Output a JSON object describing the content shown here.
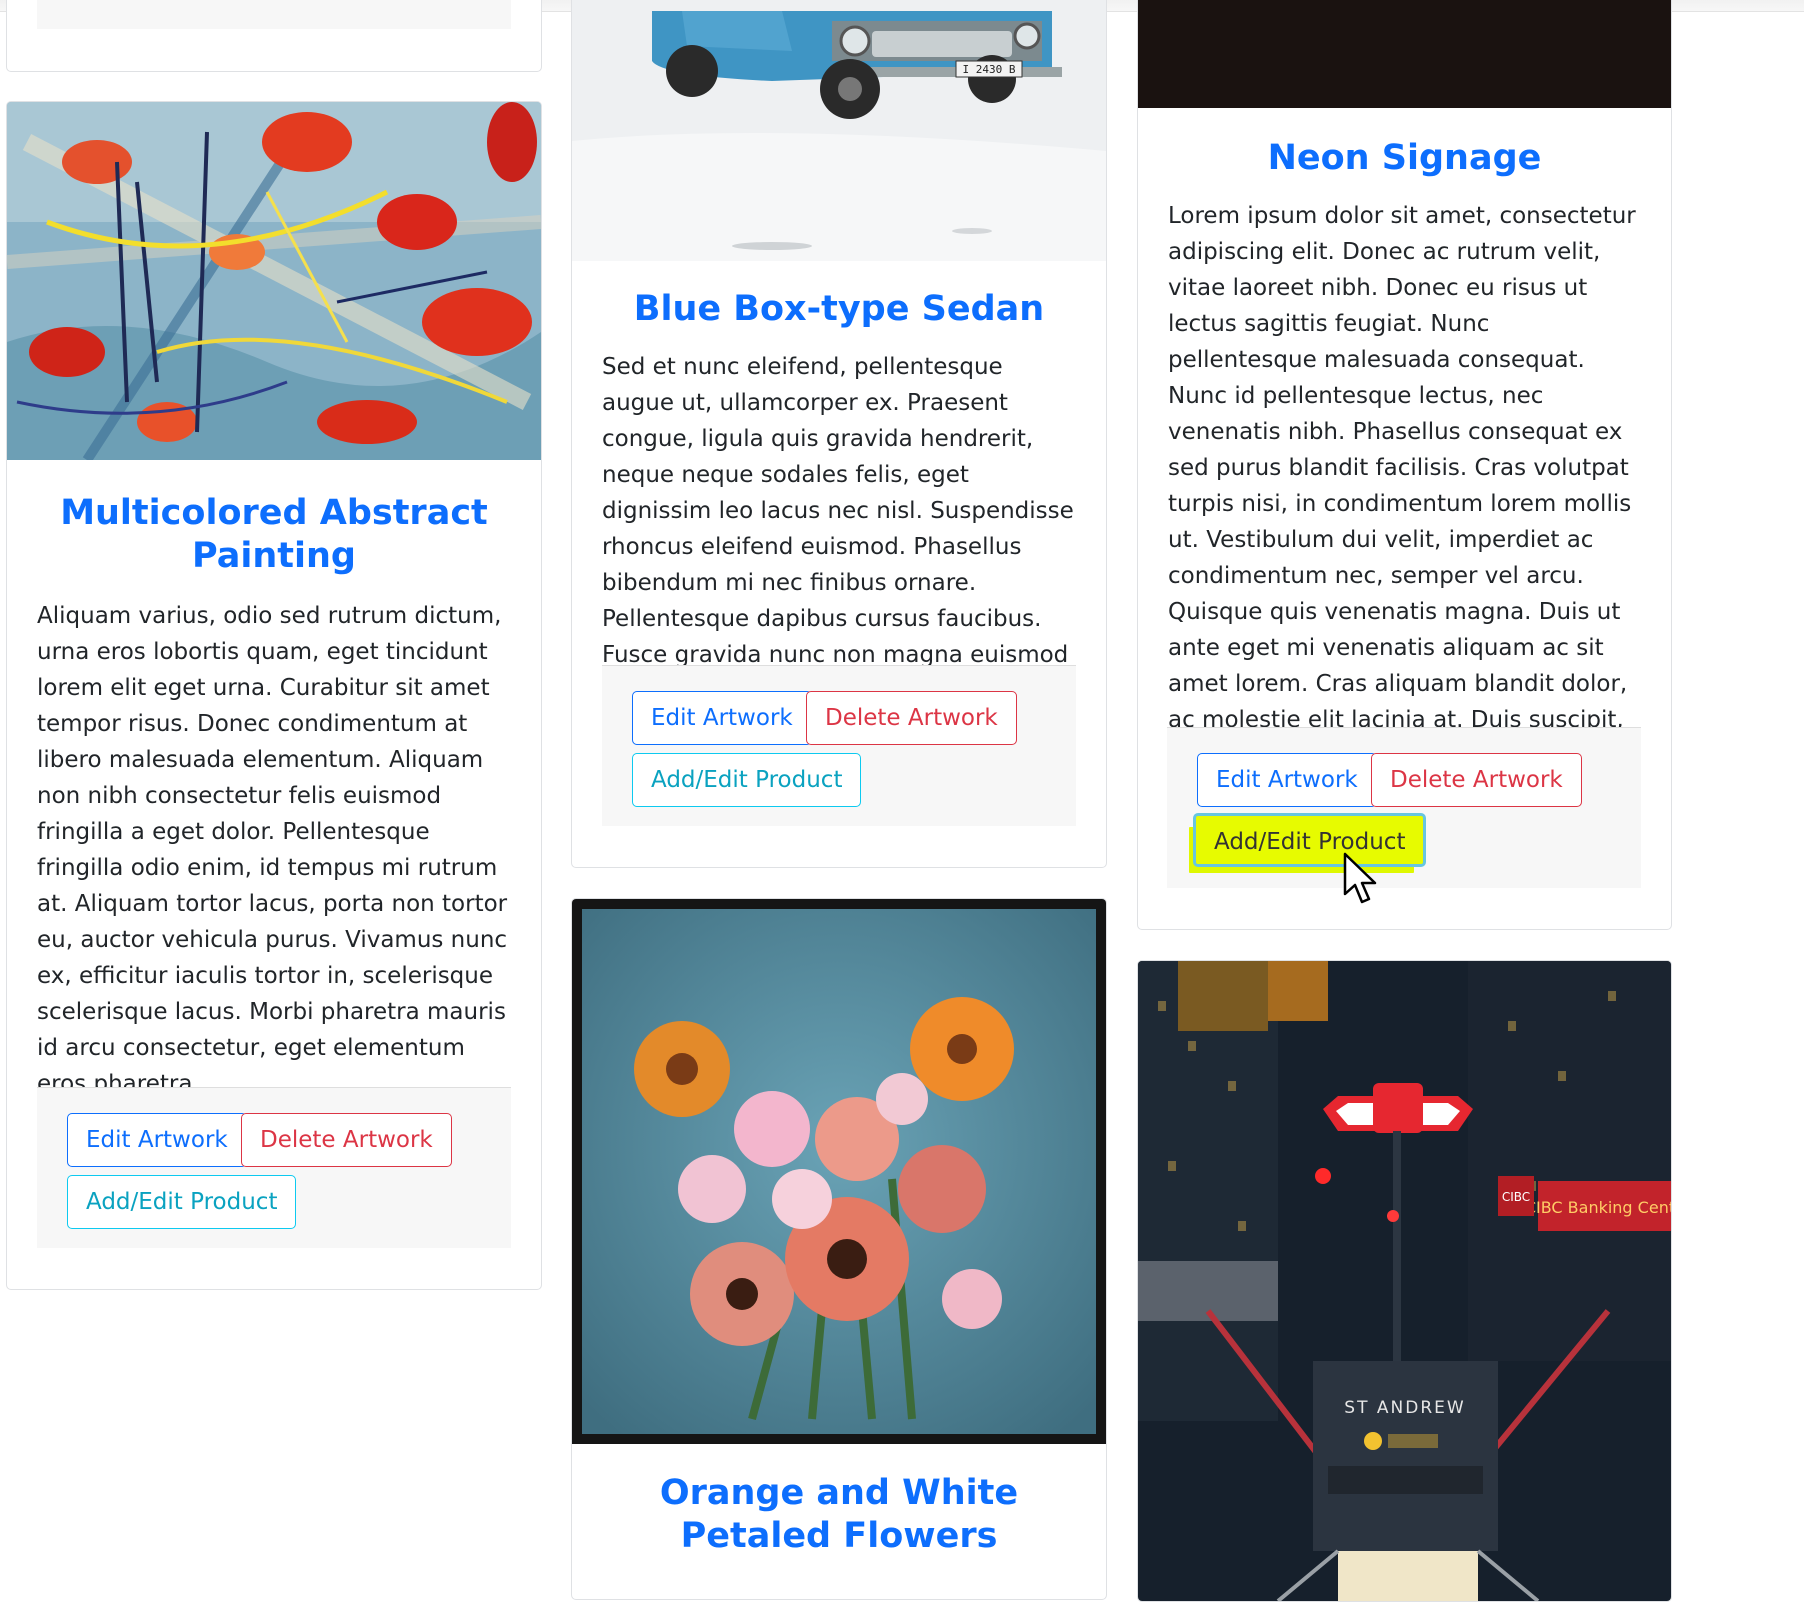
{
  "colors": {
    "title_blue": "#0d6efd",
    "edit_blue": "#0d6efd",
    "delete_red": "#dc3545",
    "product_teal": "#0dcaf0",
    "highlight_yellow": "#e7fb00"
  },
  "cards": [
    {
      "title": "Multicolored Abstract Painting",
      "description": "Aliquam varius, odio sed rutrum dictum, urna eros lobortis quam, eget tincidunt lorem elit eget urna. Curabitur sit amet tempor risus. Donec condimentum at libero malesuada elementum. Aliquam non nibh consectetur felis euismod fringilla a eget dolor. Pellentesque fringilla odio enim, id tempus mi rutrum at. Aliquam tortor lacus, porta non tortor eu, auctor vehicula purus. Vivamus nunc ex, efficitur iaculis tortor in, scelerisque scelerisque lacus. Morbi pharetra mauris id arcu consectetur, eget elementum eros pharetra.",
      "buttons": {
        "edit": "Edit Artwork",
        "delete": "Delete Artwork",
        "product": "Add/Edit Product"
      }
    },
    {
      "title": "Blue Box-type Sedan",
      "description": "Sed et nunc eleifend, pellentesque augue ut, ullamcorper ex. Praesent congue, ligula quis gravida hendrerit, neque neque sodales felis, eget dignissim leo lacus nec nisl. Suspendisse rhoncus eleifend euismod. Phasellus bibendum mi nec finibus ornare. Pellentesque dapibus cursus faucibus. Fusce gravida nunc non magna euismod ultricies.",
      "plate": "I 2430 B",
      "buttons": {
        "edit": "Edit Artwork",
        "delete": "Delete Artwork",
        "product": "Add/Edit Product"
      }
    },
    {
      "title": "Neon Signage",
      "description": "Lorem ipsum dolor sit amet, consectetur adipiscing elit. Donec ac rutrum velit, vitae laoreet nibh. Donec eu risus ut lectus sagittis feugiat. Nunc pellentesque malesuada consequat. Nunc id pellentesque lectus, nec venenatis nibh. Phasellus consequat ex sed purus blandit facilisis. Cras volutpat turpis nisi, in condimentum lorem mollis ut. Vestibulum dui velit, imperdiet ac condimentum nec, semper vel arcu. Quisque quis venenatis magna. Duis ut ante eget mi venenatis aliquam ac sit amet lorem. Cras aliquam blandit dolor, ac molestie elit lacinia at. Duis suscipit, est laoreet faucibus dictum,",
      "buttons": {
        "edit": "Edit Artwork",
        "delete": "Delete Artwork",
        "product": "Add/Edit Product"
      }
    },
    {
      "title": "Orange and White Petaled Flowers"
    },
    {
      "sign_station": "ST ANDREW",
      "sign_bank": "CIBC Banking Centre",
      "sign_cibc": "CIBC"
    }
  ],
  "cursor": {
    "icon": "mouse-pointer-icon"
  }
}
